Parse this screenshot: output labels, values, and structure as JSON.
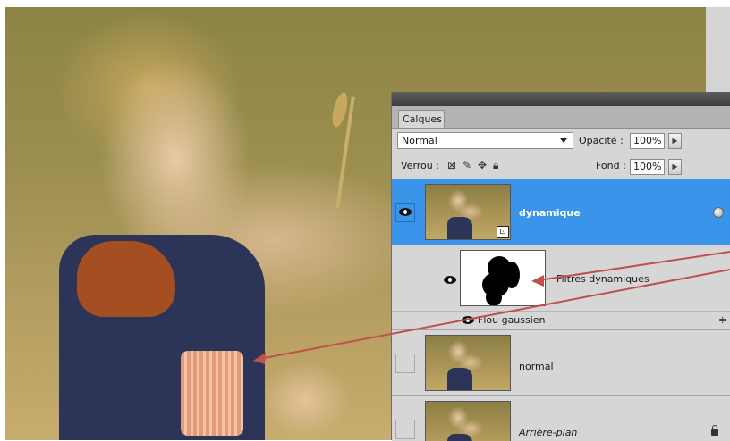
{
  "panel": {
    "tab_label": "Calques",
    "blend_mode": "Normal",
    "opacity_label": "Opacité :",
    "opacity_value": "100%",
    "lock_label": "Verrou :",
    "fill_label": "Fond :",
    "fill_value": "100%"
  },
  "layers": [
    {
      "name": "dynamique",
      "selected": true,
      "visible": true,
      "icon": "smart-object-icon"
    },
    {
      "name": "Filtres dynamiques",
      "type": "smart-filter-mask"
    },
    {
      "name": "Flou gaussien",
      "type": "smart-filter"
    },
    {
      "name": "normal",
      "visible": false
    },
    {
      "name": "Arrière-plan",
      "visible": false,
      "locked": true
    }
  ],
  "annotation": {
    "arrow_color": "#c0504d"
  },
  "colors": {
    "selection": "#3a94ea",
    "panel_bg": "#d6d6d6"
  }
}
